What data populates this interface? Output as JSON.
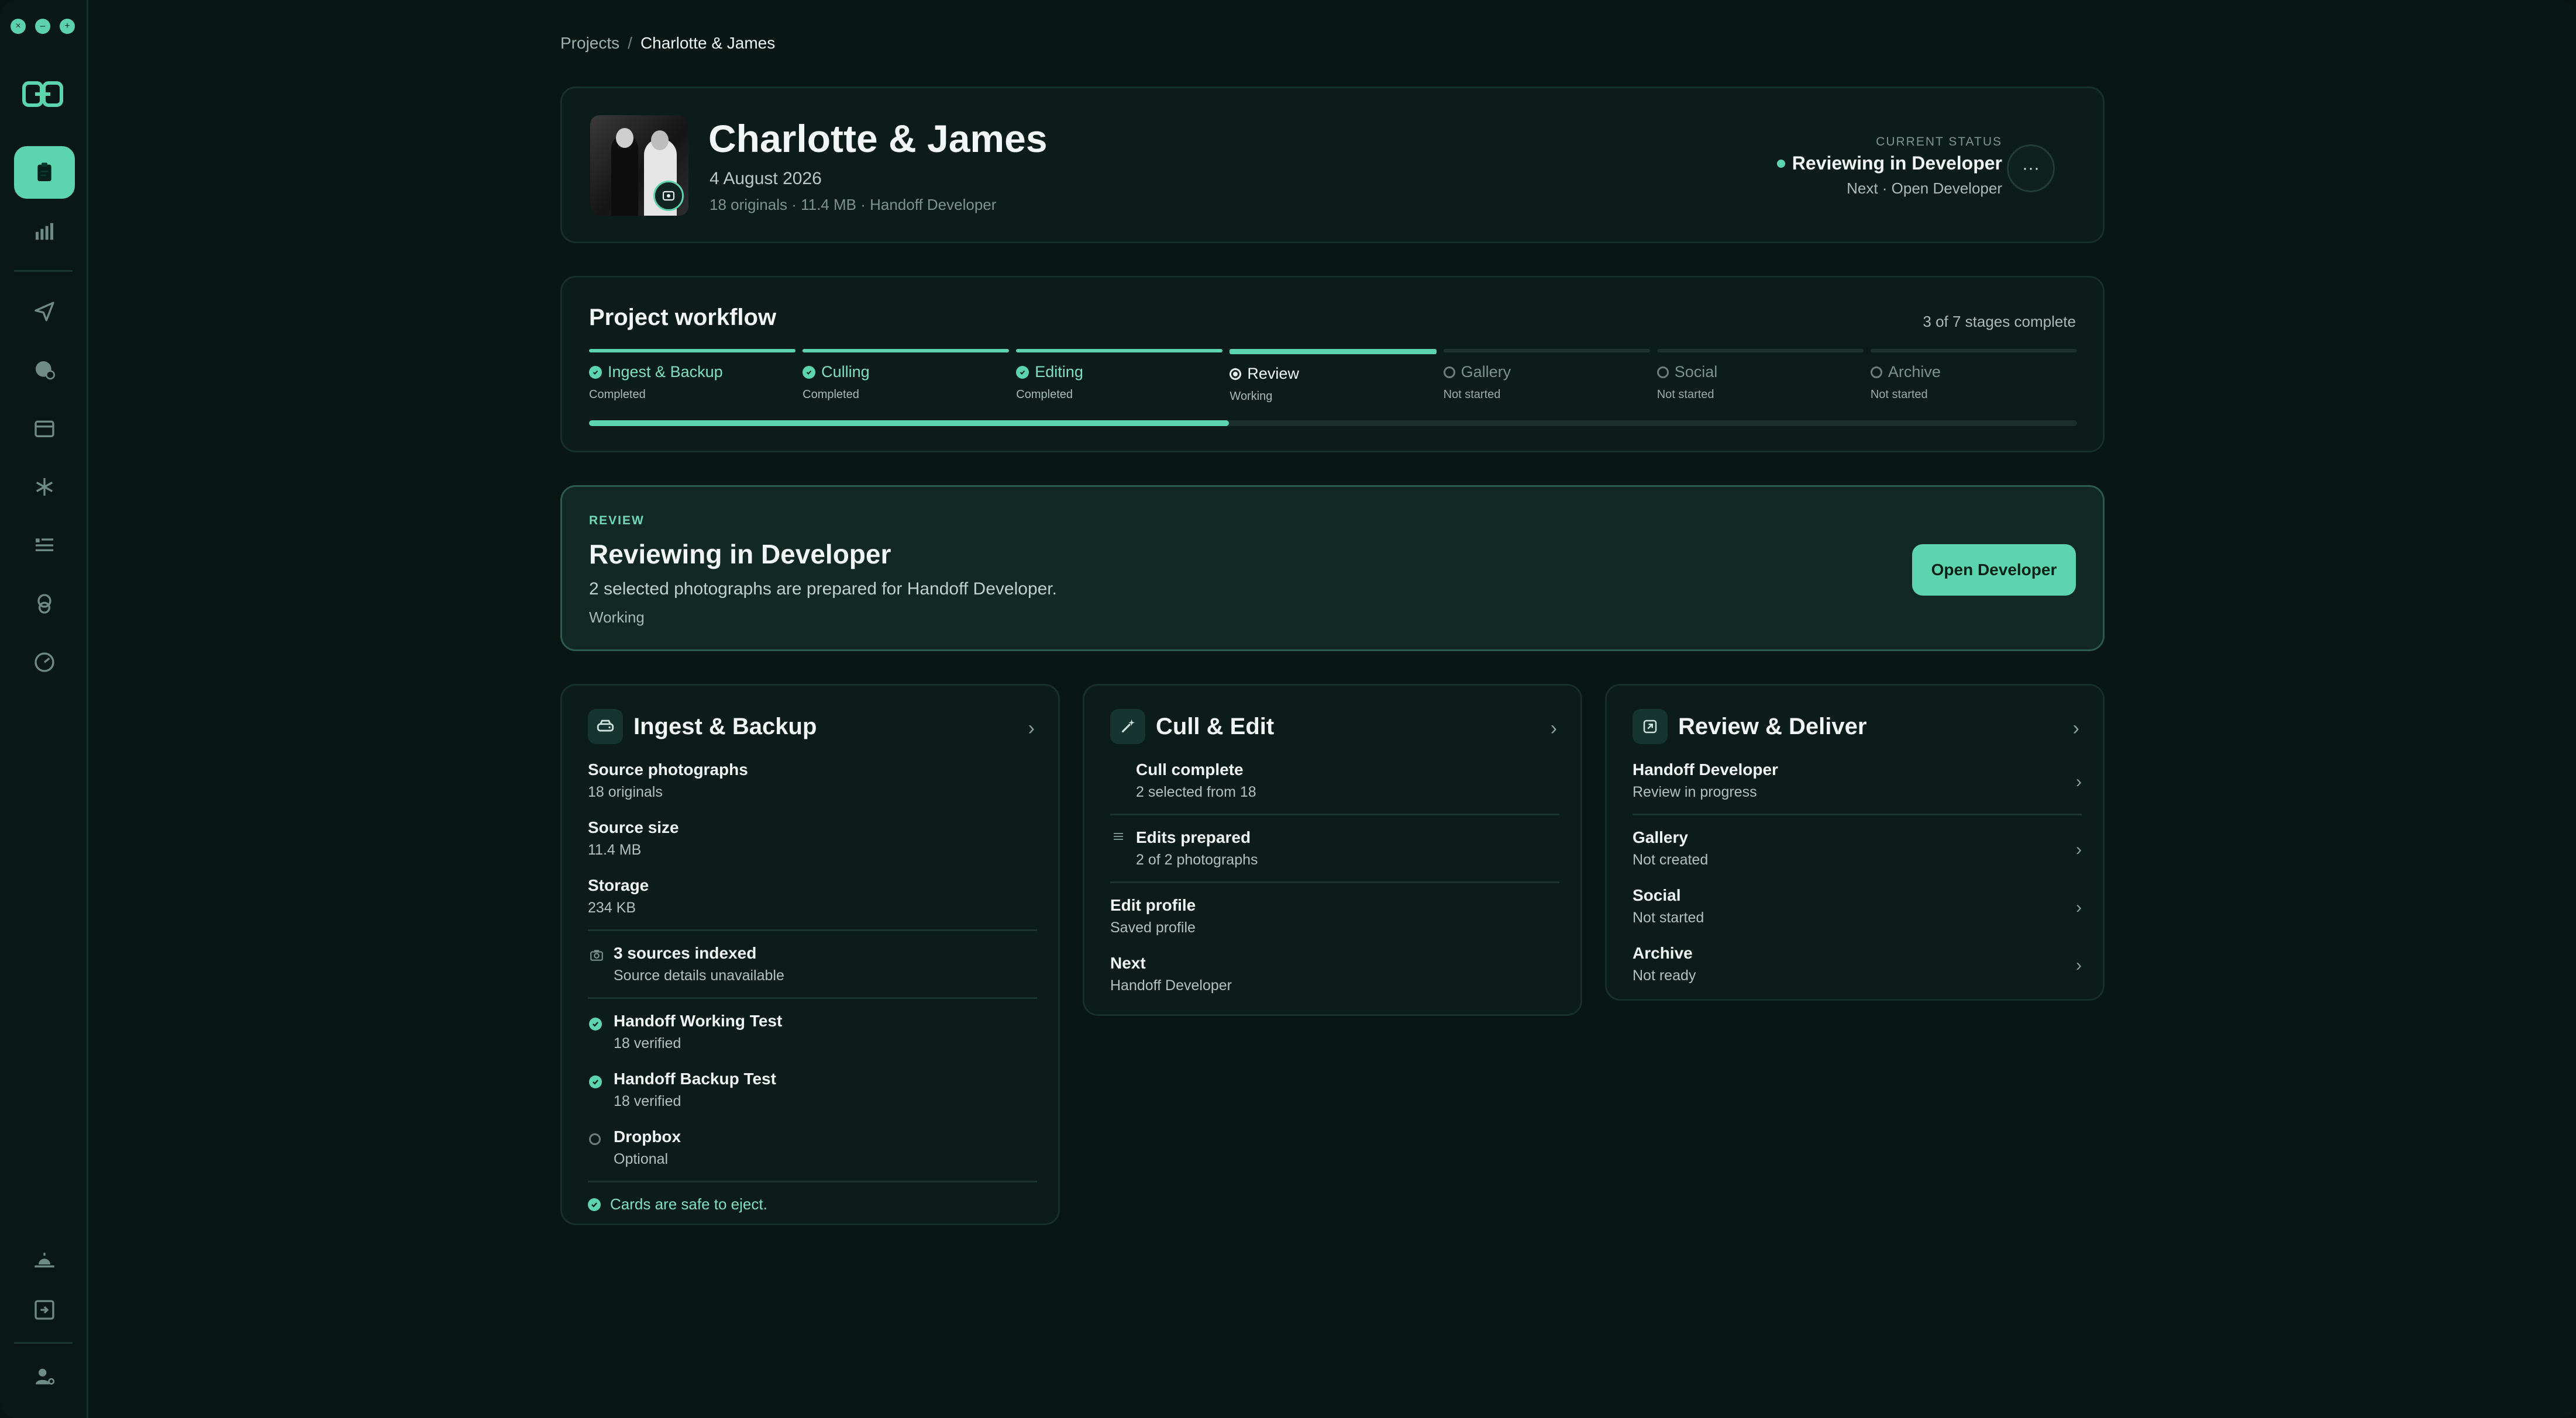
{
  "breadcrumb": {
    "root": "Projects",
    "separator": "/",
    "current": "Charlotte & James"
  },
  "project": {
    "title": "Charlotte & James",
    "date": "4 August 2026",
    "meta": "18 originals · 11.4 MB · Handoff Developer"
  },
  "status": {
    "label": "CURRENT STATUS",
    "value": "Reviewing in Developer",
    "next": "Next · Open Developer",
    "more": "···"
  },
  "workflow": {
    "title": "Project workflow",
    "count": "3 of 7 stages complete",
    "progress": 0.43,
    "stages": [
      {
        "name": "Ingest & Backup",
        "sub": "Completed",
        "state": "done"
      },
      {
        "name": "Culling",
        "sub": "Completed",
        "state": "done"
      },
      {
        "name": "Editing",
        "sub": "Completed",
        "state": "done"
      },
      {
        "name": "Review",
        "sub": "Working",
        "state": "working"
      },
      {
        "name": "Gallery",
        "sub": "Not started",
        "state": "pending"
      },
      {
        "name": "Social",
        "sub": "Not started",
        "state": "pending"
      },
      {
        "name": "Archive",
        "sub": "Not started",
        "state": "pending"
      }
    ]
  },
  "review": {
    "eyebrow": "REVIEW",
    "title": "Reviewing in Developer",
    "desc": "2 selected photographs are prepared for Handoff Developer.",
    "state": "Working",
    "button": "Open Developer"
  },
  "ingest": {
    "title": "Ingest & Backup",
    "rows": [
      {
        "label": "Source photographs",
        "value": "18 originals"
      },
      {
        "label": "Source size",
        "value": "11.4 MB"
      },
      {
        "label": "Storage",
        "value": "234 KB"
      }
    ],
    "sources": {
      "label": "3 sources indexed",
      "value": "Source details unavailable"
    },
    "backups": [
      {
        "label": "Handoff Working Test",
        "value": "18 verified",
        "state": "done"
      },
      {
        "label": "Handoff Backup Test",
        "value": "18 verified",
        "state": "done"
      },
      {
        "label": "Dropbox",
        "value": "Optional",
        "state": "empty"
      }
    ],
    "safe": "Cards are safe to eject."
  },
  "cull": {
    "title": "Cull & Edit",
    "cull_row": {
      "label": "Cull complete",
      "value": "2 selected from 18"
    },
    "edits_row": {
      "label": "Edits prepared",
      "value": "2 of 2 photographs"
    },
    "profile_row": {
      "label": "Edit profile",
      "value": "Saved profile"
    },
    "next_row": {
      "label": "Next",
      "value": "Handoff Developer"
    }
  },
  "deliver": {
    "title": "Review & Deliver",
    "rows": [
      {
        "label": "Handoff Developer",
        "value": "Review in progress"
      },
      {
        "label": "Gallery",
        "value": "Not created"
      },
      {
        "label": "Social",
        "value": "Not started"
      },
      {
        "label": "Archive",
        "value": "Not ready"
      }
    ]
  },
  "colors": {
    "accent": "#5cd4ae",
    "background": "#081614",
    "card": "#0c1c1a"
  }
}
